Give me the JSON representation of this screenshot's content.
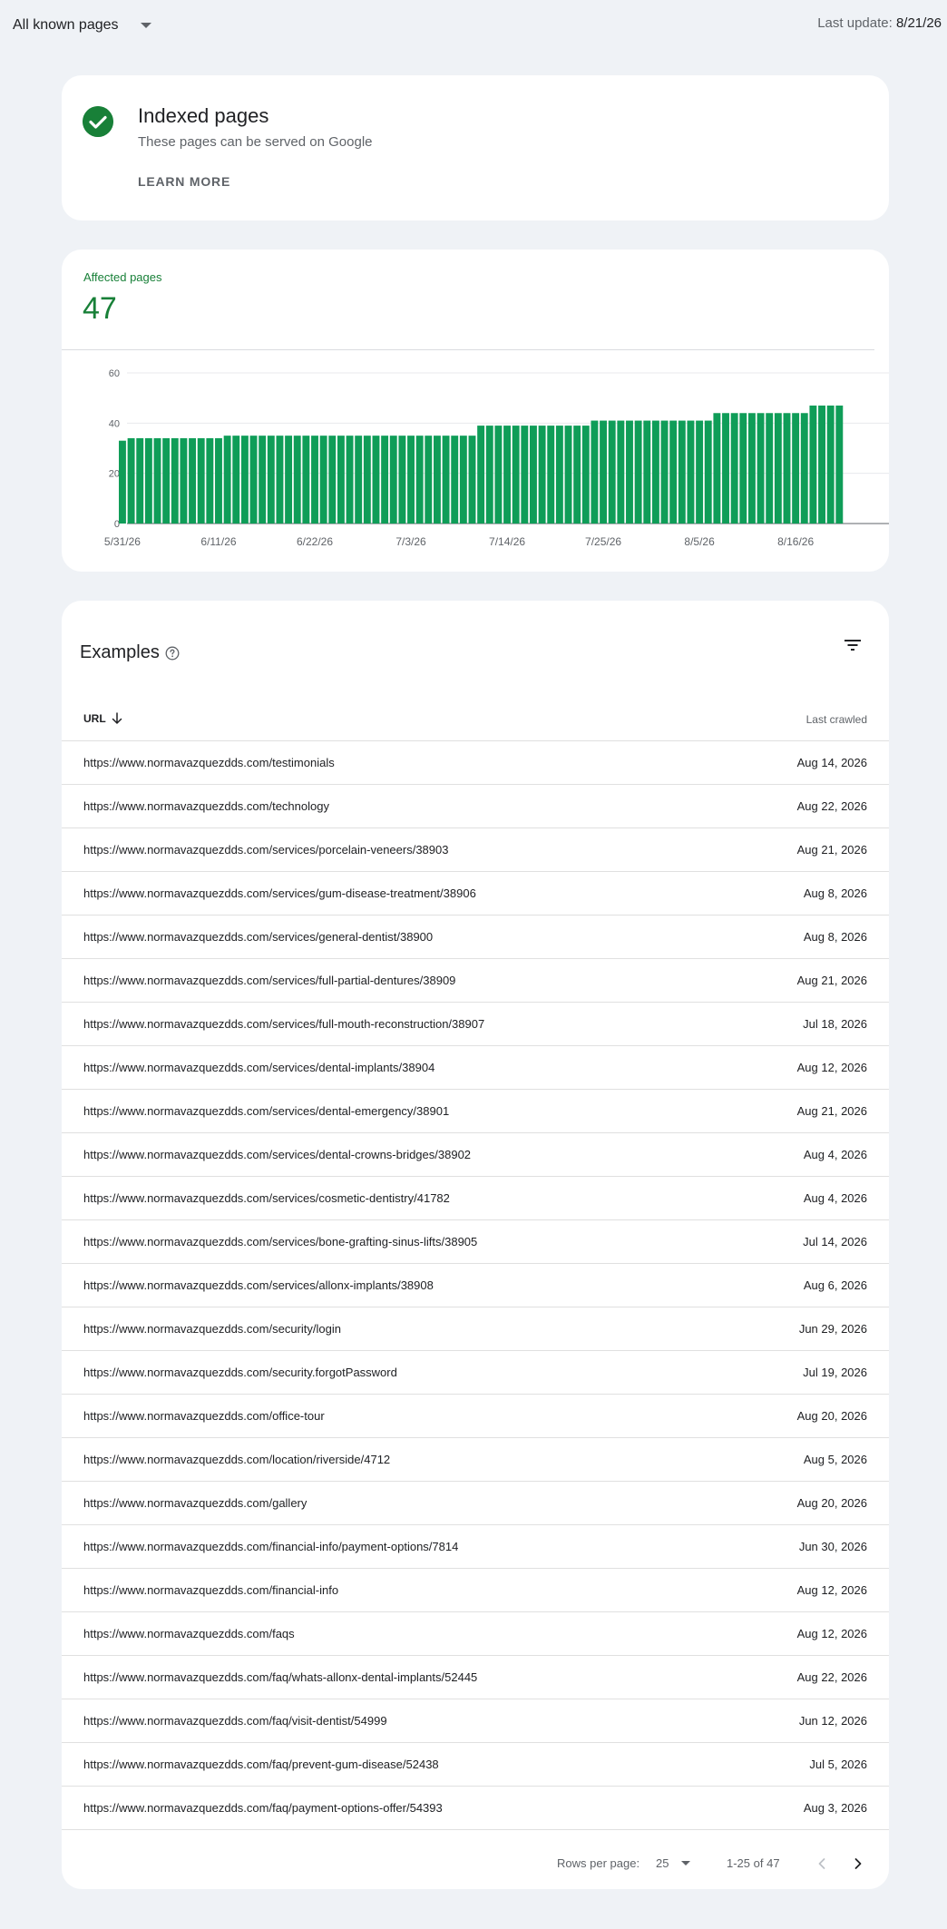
{
  "top": {
    "filter_label": "All known pages",
    "last_update_label": "Last update:",
    "last_update_value": "8/21/26"
  },
  "status": {
    "icon": "check-circle-icon",
    "title": "Indexed pages",
    "subtitle": "These pages can be served on Google",
    "learn_more": "LEARN MORE"
  },
  "affected": {
    "label": "Affected pages",
    "value": "47"
  },
  "colors": {
    "accent_green": "#188038",
    "bar_green": "#0f9d58",
    "background": "#eff2f6"
  },
  "chart_data": {
    "type": "bar",
    "title": "",
    "xlabel": "",
    "ylabel": "",
    "ylim": [
      0,
      60
    ],
    "yticks": [
      0,
      20,
      40,
      60
    ],
    "xtick_labels": [
      "5/31/26",
      "6/11/26",
      "6/22/26",
      "7/3/26",
      "7/14/26",
      "7/25/26",
      "8/5/26",
      "8/16/26"
    ],
    "grid": true,
    "categories": [
      "5/31/26",
      "6/1/26",
      "6/2/26",
      "6/3/26",
      "6/4/26",
      "6/5/26",
      "6/6/26",
      "6/7/26",
      "6/8/26",
      "6/9/26",
      "6/10/26",
      "6/11/26",
      "6/12/26",
      "6/13/26",
      "6/14/26",
      "6/15/26",
      "6/16/26",
      "6/17/26",
      "6/18/26",
      "6/19/26",
      "6/20/26",
      "6/21/26",
      "6/22/26",
      "6/23/26",
      "6/24/26",
      "6/25/26",
      "6/26/26",
      "6/27/26",
      "6/28/26",
      "6/29/26",
      "6/30/26",
      "7/1/26",
      "7/2/26",
      "7/3/26",
      "7/4/26",
      "7/5/26",
      "7/6/26",
      "7/7/26",
      "7/8/26",
      "7/9/26",
      "7/10/26",
      "7/11/26",
      "7/12/26",
      "7/13/26",
      "7/14/26",
      "7/15/26",
      "7/16/26",
      "7/17/26",
      "7/18/26",
      "7/19/26",
      "7/20/26",
      "7/21/26",
      "7/22/26",
      "7/23/26",
      "7/24/26",
      "7/25/26",
      "7/26/26",
      "7/27/26",
      "7/28/26",
      "7/29/26",
      "7/30/26",
      "7/31/26",
      "8/1/26",
      "8/2/26",
      "8/3/26",
      "8/4/26",
      "8/5/26",
      "8/6/26",
      "8/7/26",
      "8/8/26",
      "8/9/26",
      "8/10/26",
      "8/11/26",
      "8/12/26",
      "8/13/26",
      "8/14/26",
      "8/15/26",
      "8/16/26",
      "8/17/26",
      "8/18/26",
      "8/19/26",
      "8/20/26",
      "8/21/26"
    ],
    "values": [
      33,
      34,
      34,
      34,
      34,
      34,
      34,
      34,
      34,
      34,
      34,
      34,
      35,
      35,
      35,
      35,
      35,
      35,
      35,
      35,
      35,
      35,
      35,
      35,
      35,
      35,
      35,
      35,
      35,
      35,
      35,
      35,
      35,
      35,
      35,
      35,
      35,
      35,
      35,
      35,
      35,
      39,
      39,
      39,
      39,
      39,
      39,
      39,
      39,
      39,
      39,
      39,
      39,
      39,
      41,
      41,
      41,
      41,
      41,
      41,
      41,
      41,
      41,
      41,
      41,
      41,
      41,
      41,
      44,
      44,
      44,
      44,
      44,
      44,
      44,
      44,
      44,
      44,
      44,
      47,
      47,
      47,
      47
    ]
  },
  "examples": {
    "title": "Examples",
    "help_icon": "help-circle-icon",
    "filter_icon": "filter-icon",
    "col_url": "URL",
    "col_last_crawled": "Last crawled",
    "rows": [
      {
        "url": "https://www.normavazquezdds.com/testimonials",
        "date": "Aug 14, 2026"
      },
      {
        "url": "https://www.normavazquezdds.com/technology",
        "date": "Aug 22, 2026"
      },
      {
        "url": "https://www.normavazquezdds.com/services/porcelain-veneers/38903",
        "date": "Aug 21, 2026"
      },
      {
        "url": "https://www.normavazquezdds.com/services/gum-disease-treatment/38906",
        "date": "Aug 8, 2026"
      },
      {
        "url": "https://www.normavazquezdds.com/services/general-dentist/38900",
        "date": "Aug 8, 2026"
      },
      {
        "url": "https://www.normavazquezdds.com/services/full-partial-dentures/38909",
        "date": "Aug 21, 2026"
      },
      {
        "url": "https://www.normavazquezdds.com/services/full-mouth-reconstruction/38907",
        "date": "Jul 18, 2026"
      },
      {
        "url": "https://www.normavazquezdds.com/services/dental-implants/38904",
        "date": "Aug 12, 2026"
      },
      {
        "url": "https://www.normavazquezdds.com/services/dental-emergency/38901",
        "date": "Aug 21, 2026"
      },
      {
        "url": "https://www.normavazquezdds.com/services/dental-crowns-bridges/38902",
        "date": "Aug 4, 2026"
      },
      {
        "url": "https://www.normavazquezdds.com/services/cosmetic-dentistry/41782",
        "date": "Aug 4, 2026"
      },
      {
        "url": "https://www.normavazquezdds.com/services/bone-grafting-sinus-lifts/38905",
        "date": "Jul 14, 2026"
      },
      {
        "url": "https://www.normavazquezdds.com/services/allonx-implants/38908",
        "date": "Aug 6, 2026"
      },
      {
        "url": "https://www.normavazquezdds.com/security/login",
        "date": "Jun 29, 2026"
      },
      {
        "url": "https://www.normavazquezdds.com/security.forgotPassword",
        "date": "Jul 19, 2026"
      },
      {
        "url": "https://www.normavazquezdds.com/office-tour",
        "date": "Aug 20, 2026"
      },
      {
        "url": "https://www.normavazquezdds.com/location/riverside/4712",
        "date": "Aug 5, 2026"
      },
      {
        "url": "https://www.normavazquezdds.com/gallery",
        "date": "Aug 20, 2026"
      },
      {
        "url": "https://www.normavazquezdds.com/financial-info/payment-options/7814",
        "date": "Jun 30, 2026"
      },
      {
        "url": "https://www.normavazquezdds.com/financial-info",
        "date": "Aug 12, 2026"
      },
      {
        "url": "https://www.normavazquezdds.com/faqs",
        "date": "Aug 12, 2026"
      },
      {
        "url": "https://www.normavazquezdds.com/faq/whats-allonx-dental-implants/52445",
        "date": "Aug 22, 2026"
      },
      {
        "url": "https://www.normavazquezdds.com/faq/visit-dentist/54999",
        "date": "Jun 12, 2026"
      },
      {
        "url": "https://www.normavazquezdds.com/faq/prevent-gum-disease/52438",
        "date": "Jul 5, 2026"
      },
      {
        "url": "https://www.normavazquezdds.com/faq/payment-options-offer/54393",
        "date": "Aug 3, 2026"
      }
    ]
  },
  "pagination": {
    "rows_per_page_label": "Rows per page:",
    "rows_per_page_value": "25",
    "range": "1-25 of 47",
    "prev_icon": "chevron-left-icon",
    "next_icon": "chevron-right-icon"
  }
}
